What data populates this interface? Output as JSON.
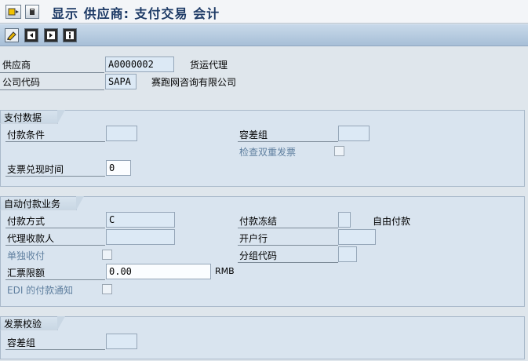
{
  "window": {
    "title": "显示 供应商: 支付交易 会计"
  },
  "titlebar_icons": [
    "menu-icon",
    "dropdown-icon"
  ],
  "toolbar_icons": [
    "edit-icon",
    "prev-icon",
    "next-icon",
    "info-icon"
  ],
  "header": {
    "vendor_label": "供应商",
    "vendor_value": "A0000002",
    "vendor_name": "货运代理",
    "company_label": "公司代码",
    "company_value": "SAPA",
    "company_name": "赛跑网咨询有限公司"
  },
  "payment_data": {
    "title": "支付数据",
    "payment_terms_label": "付款条件",
    "payment_terms_value": "",
    "tolerance_group_label": "容差组",
    "tolerance_group_value": "",
    "check_double_invoice_label": "检查双重发票",
    "check_cashing_time_label": "支票兑现时间",
    "check_cashing_time_value": "0"
  },
  "auto_payment": {
    "title": "自动付款业务",
    "payment_method_label": "付款方式",
    "payment_method_value": "C",
    "payment_block_label": "付款冻结",
    "payment_block_value": "",
    "payment_block_text": "自由付款",
    "alternate_payee_label": "代理收款人",
    "alternate_payee_value": "",
    "house_bank_label": "开户行",
    "house_bank_value": "",
    "individual_payment_label": "单独收付",
    "grouping_key_label": "分组代码",
    "grouping_key_value": "",
    "bill_limit_label": "汇票限额",
    "bill_limit_value": "0.00",
    "bill_limit_currency": "RMB",
    "edi_label": "EDI 的付款通知"
  },
  "invoice_verification": {
    "title": "发票校验",
    "tolerance_group_label": "容差组",
    "tolerance_group_value": ""
  }
}
